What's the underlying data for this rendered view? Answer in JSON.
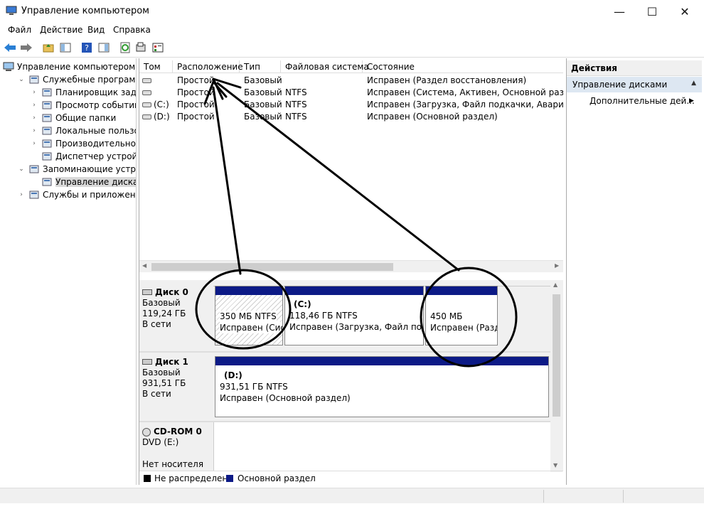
{
  "window": {
    "title": "Управление компьютером",
    "minimize": "—",
    "maximize": "☐",
    "close": "✕"
  },
  "menu": [
    "Файл",
    "Действие",
    "Вид",
    "Справка"
  ],
  "tree": {
    "root": "Управление компьютером (л",
    "items": [
      {
        "label": "Служебные программы",
        "level": 1,
        "twisty": "expanded"
      },
      {
        "label": "Планировщик заданий",
        "level": 2,
        "twisty": "collapsed"
      },
      {
        "label": "Просмотр событий",
        "level": 2,
        "twisty": "collapsed"
      },
      {
        "label": "Общие папки",
        "level": 2,
        "twisty": "collapsed"
      },
      {
        "label": "Локальные пользовате",
        "level": 2,
        "twisty": "collapsed"
      },
      {
        "label": "Производительность",
        "level": 2,
        "twisty": "collapsed"
      },
      {
        "label": "Диспетчер устройств",
        "level": 2,
        "twisty": "none"
      },
      {
        "label": "Запоминающие устройст",
        "level": 1,
        "twisty": "expanded"
      },
      {
        "label": "Управление дисками",
        "level": 2,
        "twisty": "none",
        "selected": true
      },
      {
        "label": "Службы и приложения",
        "level": 1,
        "twisty": "collapsed"
      }
    ]
  },
  "list": {
    "columns": [
      "Том",
      "Расположение",
      "Тип",
      "Файловая система",
      "Состояние"
    ],
    "rows": [
      {
        "tom": "",
        "loc": "Простой",
        "type": "Базовый",
        "fs": "",
        "state": "Исправен (Раздел восстановления)"
      },
      {
        "tom": "",
        "loc": "Простой",
        "type": "Базовый",
        "fs": "NTFS",
        "state": "Исправен (Система, Активен, Основной раздел)"
      },
      {
        "tom": "(C:)",
        "loc": "Простой",
        "type": "Базовый",
        "fs": "NTFS",
        "state": "Исправен (Загрузка, Файл подкачки, Аварийный д"
      },
      {
        "tom": "(D:)",
        "loc": "Простой",
        "type": "Базовый",
        "fs": "NTFS",
        "state": "Исправен (Основной раздел)"
      }
    ]
  },
  "disks": [
    {
      "name": "Диск 0",
      "type": "Базовый",
      "size": "119,24 ГБ",
      "status": "В сети",
      "partitions": [
        {
          "title": "",
          "line1": "350 МБ NTFS",
          "line2": "Исправен (Сис"
        },
        {
          "title": "(C:)",
          "line1": "118,46 ГБ NTFS",
          "line2": "Исправен (Загрузка, Файл подка"
        },
        {
          "title": "",
          "line1": "450 МБ",
          "line2": "Исправен (Разде"
        }
      ]
    },
    {
      "name": "Диск 1",
      "type": "Базовый",
      "size": "931,51 ГБ",
      "status": "В сети",
      "partitions": [
        {
          "title": "(D:)",
          "line1": "931,51 ГБ NTFS",
          "line2": "Исправен (Основной раздел)"
        }
      ]
    },
    {
      "name": "CD-ROM 0",
      "type": "DVD (E:)",
      "size": "",
      "status": "Нет носителя",
      "partitions": []
    }
  ],
  "legend": [
    {
      "label": "Не распределена",
      "color": "#000000"
    },
    {
      "label": "Основной раздел",
      "color": "#0c1a86"
    }
  ],
  "actions": {
    "header": "Действия",
    "section": "Управление дисками",
    "more": "Дополнительные дей..."
  },
  "colors": {
    "partition_bar": "#0c1a86",
    "annotation": "#000000"
  }
}
